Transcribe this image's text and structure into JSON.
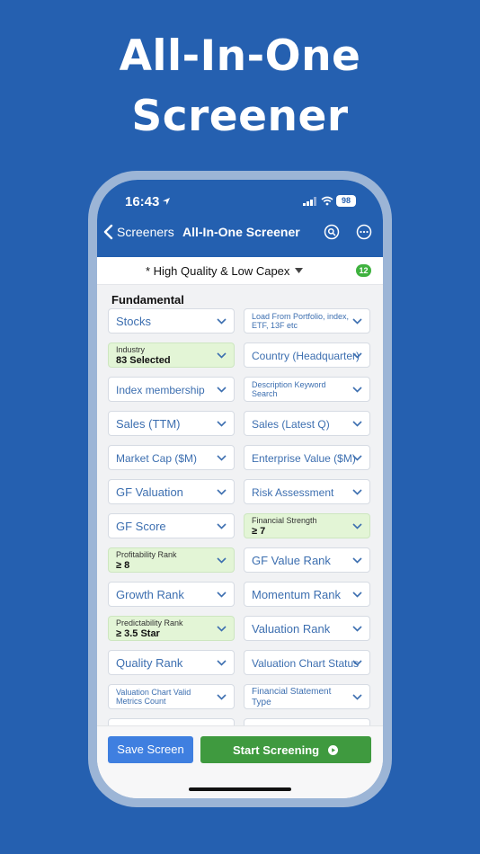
{
  "headline": {
    "line1": "All-In-One",
    "line2": "Screener"
  },
  "status_bar": {
    "time": "16:43",
    "battery": "98"
  },
  "nav": {
    "back_label": "Screeners",
    "title": "All-In-One Screener",
    "icons": [
      "search-icon",
      "more-icon"
    ]
  },
  "preset": {
    "label": "* High Quality & Low Capex",
    "count": "12"
  },
  "section": {
    "title": "Fundamental"
  },
  "fields": [
    {
      "label": "Stocks"
    },
    {
      "label": "Load From Portfolio, index, ETF, 13F etc"
    },
    {
      "label": "Industry",
      "value": "83 Selected",
      "selected": true
    },
    {
      "label": "Country (Headquarter)"
    },
    {
      "label": "Index membership"
    },
    {
      "label": "Description Keyword Search"
    },
    {
      "label": "Sales (TTM)"
    },
    {
      "label": "Sales (Latest Q)"
    },
    {
      "label": "Market Cap ($M)"
    },
    {
      "label": "Enterprise Value ($M)"
    },
    {
      "label": "GF Valuation"
    },
    {
      "label": "Risk Assessment"
    },
    {
      "label": "GF Score"
    },
    {
      "label": "Financial Strength",
      "value": "≥ 7",
      "selected": true
    },
    {
      "label": "Profitability Rank",
      "value": "≥ 8",
      "selected": true
    },
    {
      "label": "GF Value Rank"
    },
    {
      "label": "Growth Rank"
    },
    {
      "label": "Momentum Rank"
    },
    {
      "label": "Predictability Rank",
      "value": "≥ 3.5 Star",
      "selected": true
    },
    {
      "label": "Valuation Rank"
    },
    {
      "label": "Quality Rank"
    },
    {
      "label": "Valuation Chart Status"
    },
    {
      "label": "Valuation Chart Valid Metrics Count"
    },
    {
      "label": "Financial Statement Type"
    }
  ],
  "buttons": {
    "save": "Save Screen",
    "start": "Start Screening"
  },
  "colors": {
    "brand_blue": "#2460b0",
    "background": "#2560b0",
    "selected_fill": "#e3f5d6",
    "start_green": "#3f9a3f",
    "save_blue": "#3f7fe0",
    "field_text": "#3d6fb0"
  }
}
